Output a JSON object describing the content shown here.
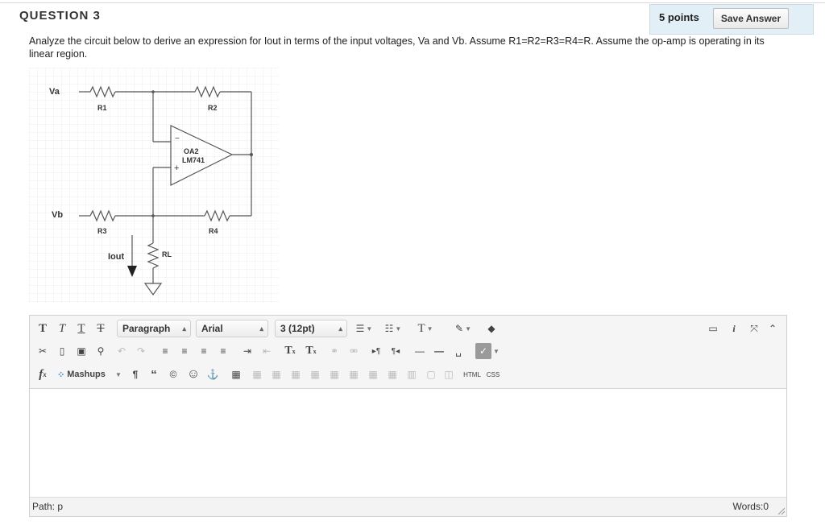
{
  "question": {
    "title": "QUESTION 3",
    "points": "5 points",
    "save_label": "Save Answer",
    "prompt": "Analyze the circuit below to derive an expression for Iout in terms of the input voltages, Va and Vb. Assume R1=R2=R3=R4=R. Assume the op-amp is operating in its linear region."
  },
  "circuit": {
    "va": "Va",
    "vb": "Vb",
    "r1": "R1",
    "r2": "R2",
    "r3": "R3",
    "r4": "R4",
    "rl": "RL",
    "iout": "Iout",
    "opamp_name": "OA2",
    "opamp_part": "LM741",
    "minus": "−",
    "plus": "+"
  },
  "editor": {
    "paragraph": "Paragraph",
    "font": "Arial",
    "size": "3 (12pt)",
    "mashups": "Mashups",
    "html": "HTML",
    "css": "CSS",
    "path": "Path: p",
    "words": "Words:0"
  },
  "icons": {
    "bold": "T",
    "italic": "T",
    "underline": "T",
    "strike": "T",
    "text_color": "T",
    "superscript": "T",
    "subscript": "T",
    "fx": "f",
    "pilcrow": "¶",
    "quote": "“",
    "copyright": "©",
    "smiley": "☺",
    "anchor": "⚓"
  },
  "colors": {
    "panel": "#e3eff6",
    "grid": "#e8e8e8",
    "wire": "#555555"
  }
}
